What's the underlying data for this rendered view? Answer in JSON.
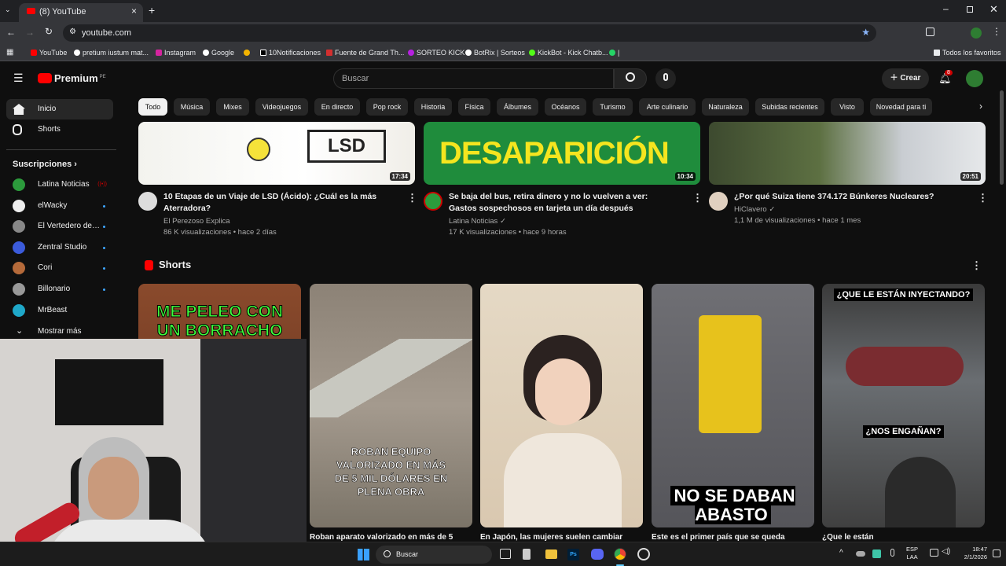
{
  "browser": {
    "tab_title": "(8) YouTube",
    "url": "youtube.com",
    "bookmarks": [
      "YouTube",
      "pretium iustum mat...",
      "Instagram",
      "Google",
      "",
      "10Notificaciones",
      "Fuente de Grand Th...",
      "SORTEO KICK",
      "BotRix | Sorteos",
      "KickBot - Kick Chatb...",
      "|"
    ],
    "all_bookmarks": "Todos los favoritos"
  },
  "masthead": {
    "logo": "Premium",
    "region": "PE",
    "search_placeholder": "Buscar",
    "create_label": "Crear",
    "notification_count": "8"
  },
  "chips": [
    "Todo",
    "Música",
    "Mixes",
    "Videojuegos",
    "En directo",
    "Pop rock",
    "Historia",
    "Física",
    "Álbumes",
    "Océanos",
    "Turismo",
    "Arte culinario",
    "Naturaleza",
    "Subidas recientes",
    "Visto",
    "Novedad para ti"
  ],
  "sidebar": {
    "nav": [
      {
        "label": "Inicio"
      },
      {
        "label": "Shorts"
      }
    ],
    "subs_heading": "Suscripciones",
    "subscriptions": [
      {
        "label": "Latina Noticias",
        "color": "#2c9b3c"
      },
      {
        "label": "elWacky",
        "color": "#eeeeee"
      },
      {
        "label": "El Vertedero de ...",
        "color": "#888888"
      },
      {
        "label": "Zentral Studio",
        "color": "#3b5bdb"
      },
      {
        "label": "Cori",
        "color": "#b56a3a"
      },
      {
        "label": "Billonario",
        "color": "#999999"
      },
      {
        "label": "MrBeast",
        "color": "#1fa8c9"
      }
    ],
    "more_label": "Mostrar más"
  },
  "videos": [
    {
      "title": "10 Etapas de un Viaje de LSD (Ácido): ¿Cuál es la más Aterradora?",
      "channel": "El Perezoso Explica",
      "meta": "86 K visualizaciones • hace 2 días",
      "duration": "17:34",
      "thumb_text": "LSD"
    },
    {
      "title": "Se baja del bus, retira dinero y no lo vuelven a ver: Gastos sospechosos en tarjeta un día después",
      "channel": "Latina Noticias",
      "meta": "17 K visualizaciones • hace 9 horas",
      "duration": "10:34",
      "thumb_text": "DESAPARICIÓN"
    },
    {
      "title": "¿Por qué Suiza tiene 374.172 Búnkeres Nucleares?",
      "channel": "HiClavero",
      "meta": "1,1 M de visualizaciones • hace 1 mes",
      "duration": "20:51"
    }
  ],
  "shorts": {
    "heading": "Shorts",
    "items": [
      {
        "caption": "ME PELEO CON UN BORRACHO",
        "title": ""
      },
      {
        "caption": "ROBAN EQUIPO VALORIZADO EN MÁS DE 5 MIL DÓLARES EN PLENA OBRA",
        "title": "Roban aparato valorizado en más de 5"
      },
      {
        "caption": "",
        "title": "En Japón, las mujeres suelen cambiar"
      },
      {
        "caption": "NO SE DABAN ABASTO",
        "title": "Este es el primer país que se queda"
      },
      {
        "caption": "¿QUE LE ESTÁN INYECTANDO?",
        "caption2": "¿NOS ENGAÑAN?",
        "title": "¿Que le están"
      }
    ]
  },
  "taskbar": {
    "search_label": "Buscar",
    "lang": "ESP",
    "lang_sub": "LAA",
    "time": "18:47",
    "date": "2/1/2026"
  },
  "colors": {
    "brand": "#ff0000",
    "bg": "#0f0f0f",
    "chip_bg": "#272727",
    "link": "#3ea6ff"
  }
}
